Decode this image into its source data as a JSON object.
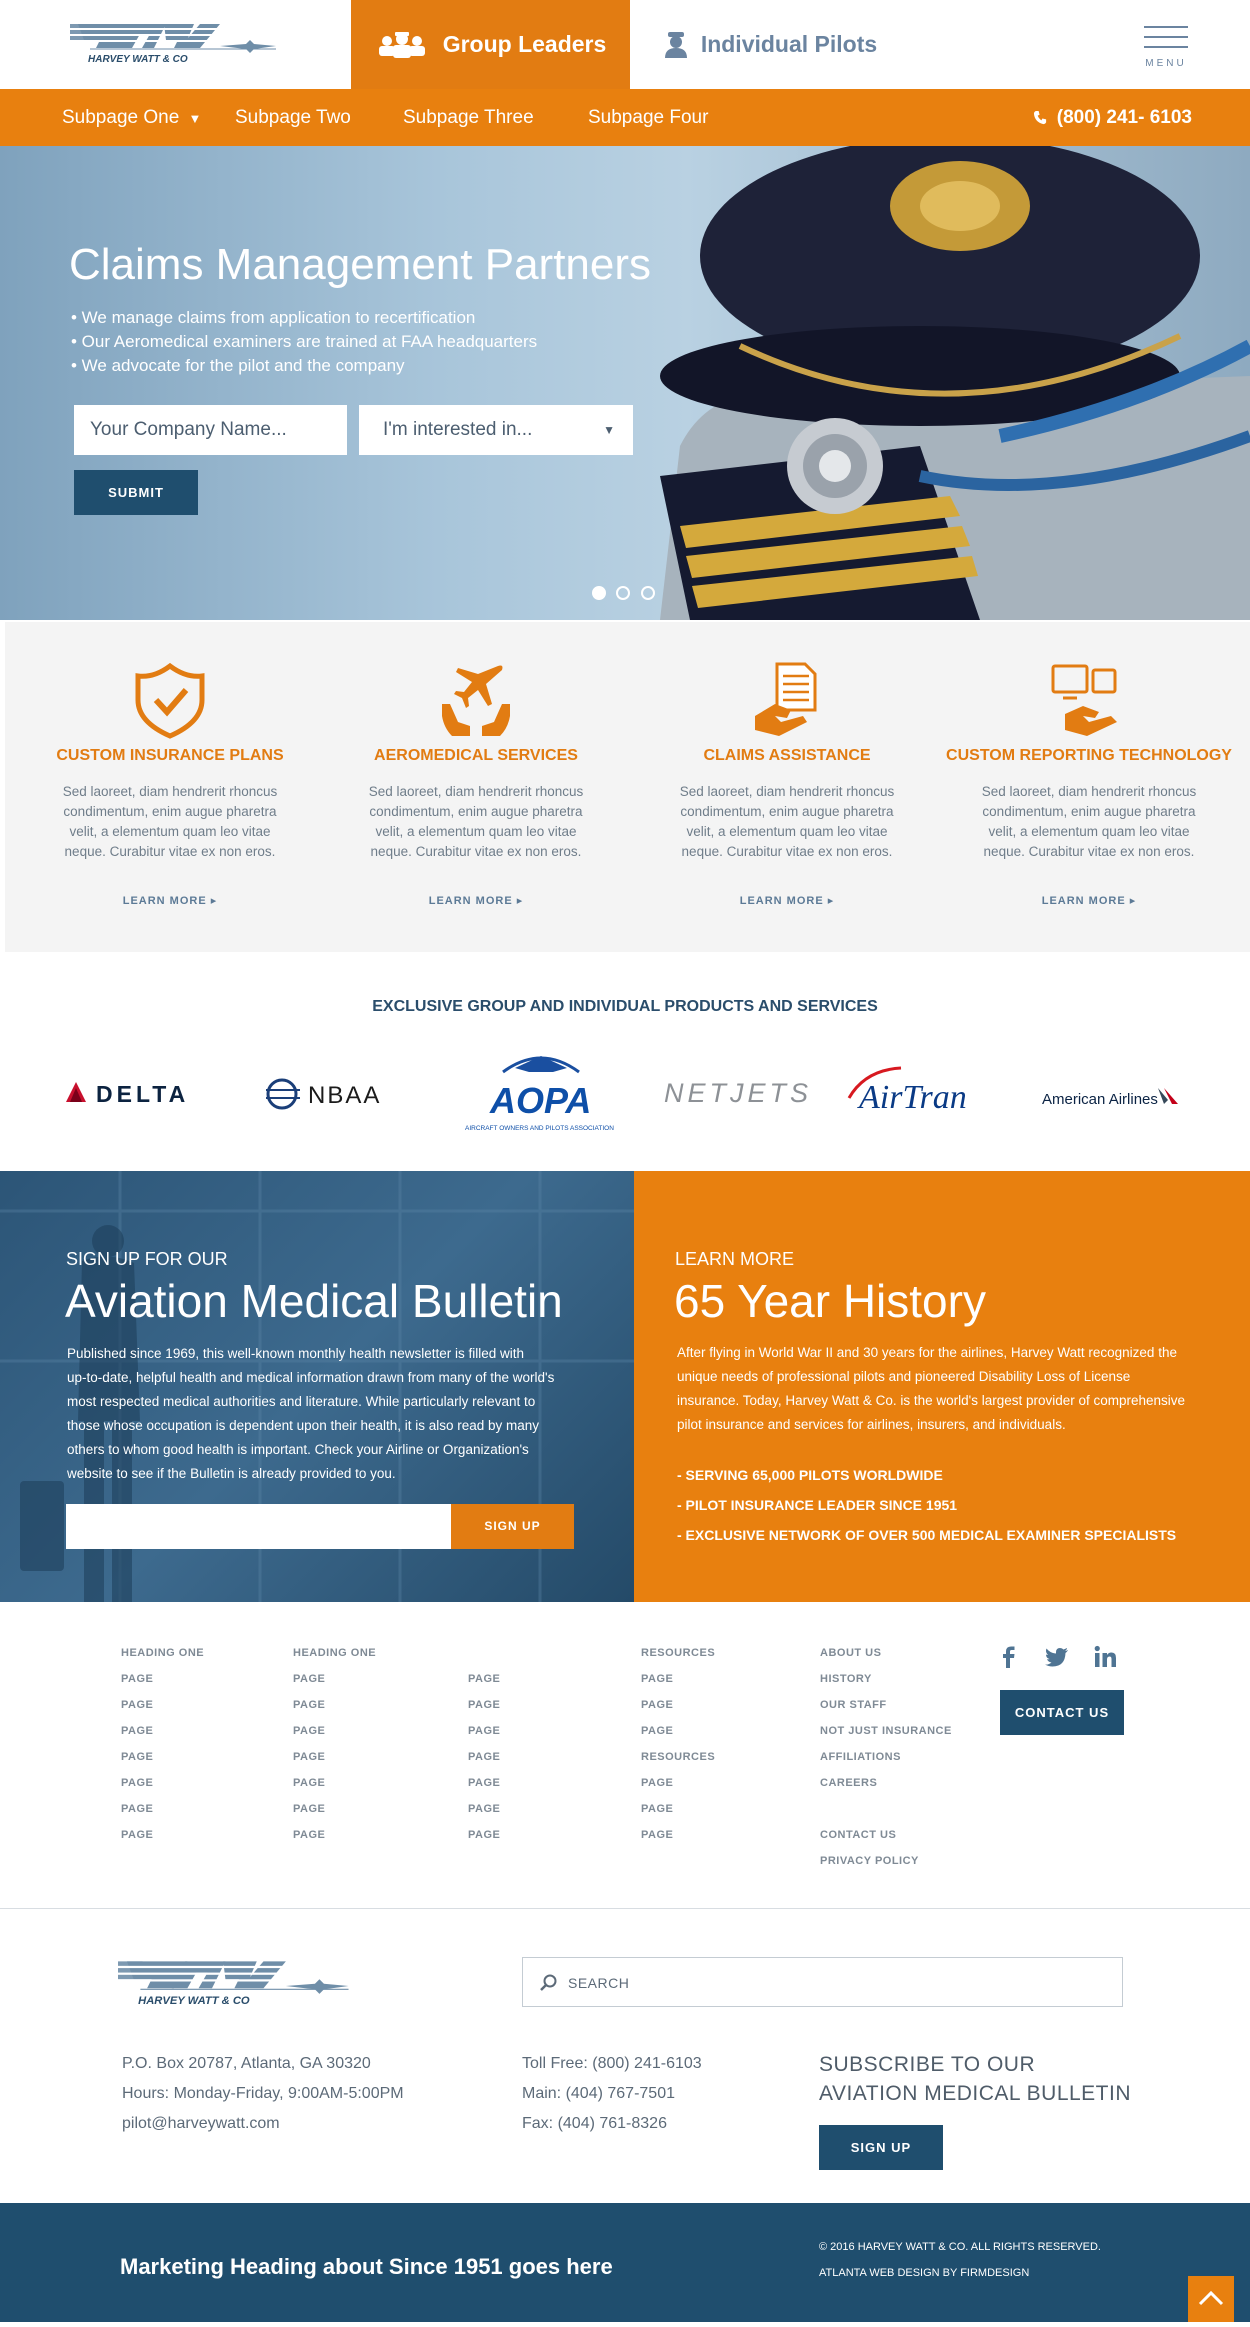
{
  "colors": {
    "orange": "#e8800f",
    "navy": "#1f4e6e",
    "text_blue": "#2a4d6b"
  },
  "header": {
    "logo_text": "HARVEY WATT & CO",
    "tab_group": "Group Leaders",
    "tab_pilots": "Individual Pilots",
    "menu_label": "MENU",
    "icons": {
      "group": "group-leaders-icon",
      "pilot": "pilot-icon",
      "menu": "hamburger-icon"
    }
  },
  "nav": {
    "items": [
      "Subpage One",
      "Subpage Two",
      "Subpage Three",
      "Subpage Four"
    ],
    "phone": "(800) 241- 6103"
  },
  "hero": {
    "title": "Claims Management Partners",
    "bullets": [
      "• We manage claims from application to recertification",
      "• Our Aeromedical examiners are trained at FAA headquarters",
      "• We advocate for the pilot and the company"
    ],
    "company_placeholder": "Your Company Name...",
    "interest_placeholder": "I'm interested in...",
    "submit": "SUBMIT"
  },
  "services": [
    {
      "title": "CUSTOM INSURANCE PLANS",
      "desc": "Sed laoreet, diam hendrerit rhoncus condimentum, enim augue pharetra velit, a elementum quam leo vitae neque. Curabitur vitae ex non eros.",
      "more": "LEARN MORE ▸",
      "icon": "shield-check-icon"
    },
    {
      "title": "AEROMEDICAL SERVICES",
      "desc": "Sed laoreet, diam hendrerit rhoncus condimentum, enim augue pharetra velit, a elementum quam leo vitae neque. Curabitur vitae ex non eros.",
      "more": "LEARN MORE ▸",
      "icon": "plane-hands-icon"
    },
    {
      "title": "CLAIMS ASSISTANCE",
      "desc": "Sed laoreet, diam hendrerit rhoncus condimentum, enim augue pharetra velit, a elementum quam leo vitae neque. Curabitur vitae ex non eros.",
      "more": "LEARN MORE ▸",
      "icon": "document-hand-icon"
    },
    {
      "title": "CUSTOM REPORTING TECHNOLOGY",
      "desc": "Sed laoreet, diam hendrerit rhoncus condimentum, enim augue pharetra velit, a elementum quam leo vitae neque. Curabitur vitae ex non eros.",
      "more": "LEARN MORE ▸",
      "icon": "devices-hand-icon"
    }
  ],
  "partners": {
    "title": "EXCLUSIVE GROUP AND  INDIVIDUAL PRODUCTS AND SERVICES",
    "logos": [
      "DELTA",
      "NBAA",
      "AOPA",
      "NETJETS",
      "AirTran",
      "American Airlines"
    ],
    "aopa_sub": "AIRCRAFT OWNERS AND PILOTS ASSOCIATION"
  },
  "bulletin": {
    "kicker": "SIGN UP FOR OUR",
    "title": "Aviation Medical Bulletin",
    "lines": [
      "Published since 1969, this well-known monthly health newsletter is filled with",
      "up-to-date, helpful health and medical information drawn from many of the world's",
      "most respected medical authorities and literature. While particularly relevant to",
      "those whose occupation is dependent upon their health, it is also read by many",
      "others to whom good health is important.  Check your Airline or Organization's",
      "website to see if the Bulletin is already provided to you."
    ],
    "signup": "SIGN UP"
  },
  "history": {
    "kicker": "LEARN MORE",
    "title": "65 Year History",
    "lines": [
      "After flying in World War II and 30 years for the airlines, Harvey Watt recognized the",
      "unique needs of professional pilots and pioneered Disability Loss of License",
      "insurance. Today, Harvey Watt & Co. is the world's largest provider of comprehensive",
      "pilot insurance and services for airlines, insurers, and individuals."
    ],
    "bullets": [
      "- SERVING 65,000 PILOTS WORLDWIDE",
      "- PILOT INSURANCE LEADER SINCE 1951",
      "- EXCLUSIVE NETWORK OF OVER 500 MEDICAL EXAMINER SPECIALISTS"
    ]
  },
  "footer_links": {
    "col1": [
      "HEADING ONE",
      "PAGE",
      "PAGE",
      "PAGE",
      "PAGE",
      "PAGE",
      "PAGE",
      "PAGE"
    ],
    "col2": [
      "HEADING ONE",
      "PAGE",
      "PAGE",
      "PAGE",
      "PAGE",
      "PAGE",
      "PAGE",
      "PAGE"
    ],
    "col3": [
      "PAGE",
      "PAGE",
      "PAGE",
      "PAGE",
      "PAGE",
      "PAGE",
      "PAGE"
    ],
    "col4": [
      "RESOURCES",
      "PAGE",
      "PAGE",
      "PAGE",
      "RESOURCES",
      "PAGE",
      "PAGE",
      "PAGE"
    ],
    "col5": [
      "ABOUT US",
      "HISTORY",
      "OUR STAFF",
      "NOT JUST INSURANCE",
      "AFFILIATIONS",
      "CAREERS",
      "",
      "CONTACT US",
      "PRIVACY POLICY"
    ],
    "social": [
      "facebook-icon",
      "twitter-icon",
      "linkedin-icon"
    ],
    "contact": "CONTACT US"
  },
  "contact": {
    "address": "P.O. Box 20787, Atlanta, GA 30320",
    "hours": "Hours: Monday-Friday, 9:00AM-5:00PM",
    "email": "pilot@harveywatt.com",
    "tollfree": "Toll Free: (800) 241-6103",
    "main": "Main: (404) 767-7501",
    "fax": "Fax: (404) 761-8326",
    "search_placeholder": "SEARCH",
    "subscribe_line1": "SUBSCRIBE TO OUR",
    "subscribe_line2": "AVIATION MEDICAL BULLETIN",
    "signup": "SIGN UP"
  },
  "bottom": {
    "marketing": "Marketing Heading about Since 1951 goes here",
    "copyright": "© 2016 HARVEY WATT & CO. ALL RIGHTS RESERVED.",
    "credit": "ATLANTA WEB DESIGN BY FIRMDESIGN"
  }
}
